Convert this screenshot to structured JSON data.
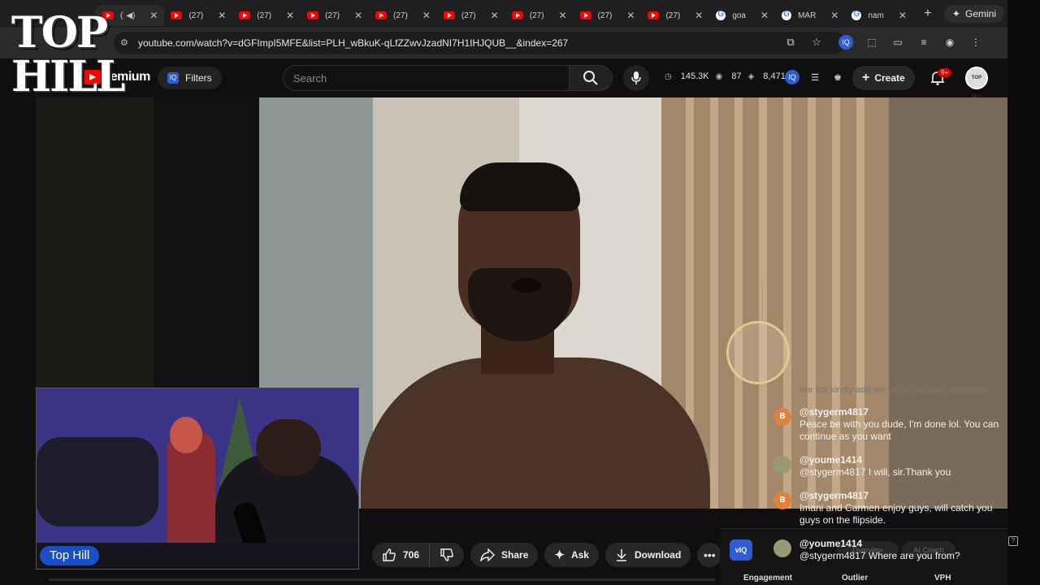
{
  "browser": {
    "tabs": [
      {
        "label": "(",
        "type": "yt",
        "active": true
      },
      {
        "label": "(27)",
        "type": "yt"
      },
      {
        "label": "(27)",
        "type": "yt"
      },
      {
        "label": "(27)",
        "type": "yt"
      },
      {
        "label": "(27)",
        "type": "yt"
      },
      {
        "label": "(27)",
        "type": "yt"
      },
      {
        "label": "(27)",
        "type": "yt"
      },
      {
        "label": "(27)",
        "type": "yt"
      },
      {
        "label": "(27)",
        "type": "yt"
      },
      {
        "label": "goa",
        "type": "g"
      },
      {
        "label": "MAR",
        "type": "g"
      },
      {
        "label": "nam",
        "type": "g"
      }
    ],
    "new_tab": "+",
    "gemini_label": "Gemini",
    "url": "youtube.com/watch?v=dGFImpI5MFE&list=PLH_wBkuK-qLfZZwvJzadNI7H1IHJQUB__&index=267"
  },
  "overlay": {
    "logo_line1": "TOP",
    "logo_line2": "HILL",
    "pip_label": "Top Hill"
  },
  "youtube": {
    "logo_text": "remium",
    "filters_label": "Filters",
    "search_placeholder": "Search",
    "stats": {
      "views": "145.3K",
      "eye": "87",
      "count": "8,471"
    },
    "create_label": "Create",
    "notifications": "9+",
    "avatar_text": "TOP HILL"
  },
  "actions": {
    "likes": "706",
    "share": "Share",
    "ask": "Ask",
    "download": "Download",
    "more": "•••"
  },
  "chat": {
    "ghost": "like too kindly add me up on dis-card: brenderts",
    "messages": [
      {
        "author": "@stygerm4817",
        "avatar": "B",
        "text": "Peace be with you dude, I'm done lol. You can continue as you want"
      },
      {
        "author": "@youme1414",
        "avatar": "",
        "text": "@stygerm4817 I will, sir.Thank you"
      },
      {
        "author": "@stygerm4817",
        "avatar": "B",
        "text": "Imani and Carmen enjoy guys, will catch you guys on the flipside."
      },
      {
        "author": "@youme1414",
        "avatar": "",
        "text": "@stygerm4817 Where are you from?"
      }
    ]
  },
  "extension": {
    "logo": "vIQ",
    "pill1": "Overview",
    "pill2": "AI Coach",
    "tab1": "Engagement",
    "tab2": "Outlier",
    "tab3": "VPH",
    "help": "?"
  },
  "colors": {
    "yt_red": "#ff0000",
    "accent_blue": "#2f5bd3",
    "pip_label_blue": "#1a4ec8"
  }
}
